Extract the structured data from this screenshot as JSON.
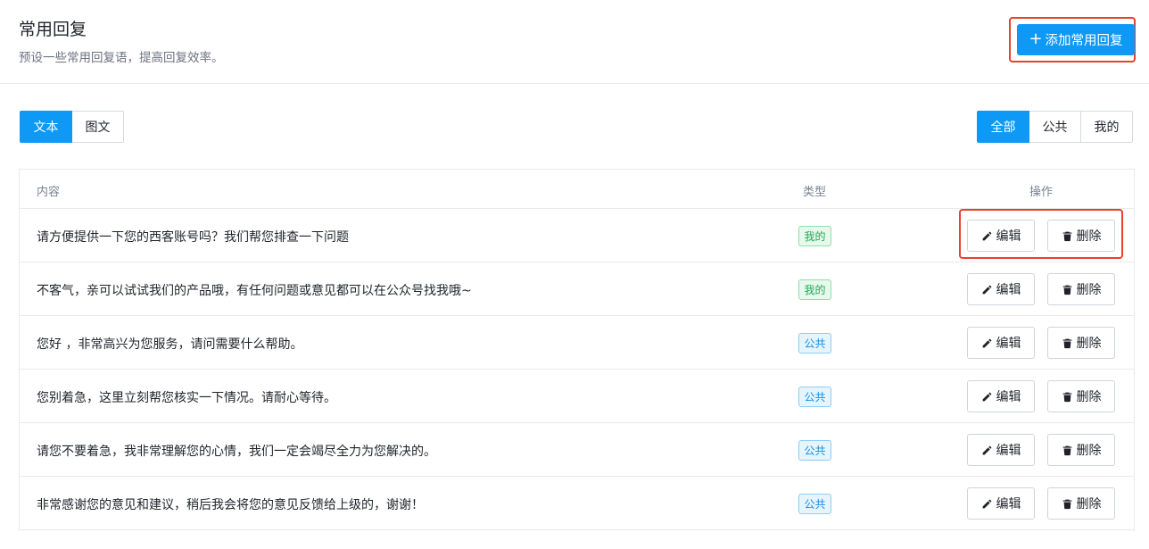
{
  "header": {
    "title": "常用回复",
    "subtitle": "预设一些常用回复语，提高回复效率。",
    "add_button": {
      "icon": "plus-icon",
      "label": "添加常用回复"
    }
  },
  "type_tabs": [
    {
      "label": "文本",
      "active": true
    },
    {
      "label": "图文",
      "active": false
    }
  ],
  "filter_tabs": [
    {
      "label": "全部",
      "active": true
    },
    {
      "label": "公共",
      "active": false
    },
    {
      "label": "我的",
      "active": false
    }
  ],
  "table": {
    "columns": {
      "content": "内容",
      "type": "类型",
      "ops": "操作"
    },
    "rows": [
      {
        "content": "请方便提供一下您的西客账号吗？我们帮您排查一下问题",
        "type": "我的",
        "type_kind": "mine"
      },
      {
        "content": "不客气，亲可以试试我们的产品哦，有任何问题或意见都可以在公众号找我哦~",
        "type": "我的",
        "type_kind": "mine"
      },
      {
        "content": "您好 ，非常高兴为您服务，请问需要什么帮助。",
        "type": "公共",
        "type_kind": "public"
      },
      {
        "content": "您别着急，这里立刻帮您核实一下情况。请耐心等待。",
        "type": "公共",
        "type_kind": "public"
      },
      {
        "content": "请您不要着急，我非常理解您的心情，我们一定会竭尽全力为您解决的。",
        "type": "公共",
        "type_kind": "public"
      },
      {
        "content": "非常感谢您的意见和建议，稍后我会将您的意见反馈给上级的，谢谢！",
        "type": "公共",
        "type_kind": "public"
      }
    ],
    "edit_label": "编辑",
    "delete_label": "删除",
    "edit_icon": "pencil-icon",
    "delete_icon": "trash-icon"
  },
  "colors": {
    "primary": "#0d99f5",
    "highlight": "#e8412c",
    "mine_badge": "#22a854",
    "public_badge": "#1290e8"
  }
}
